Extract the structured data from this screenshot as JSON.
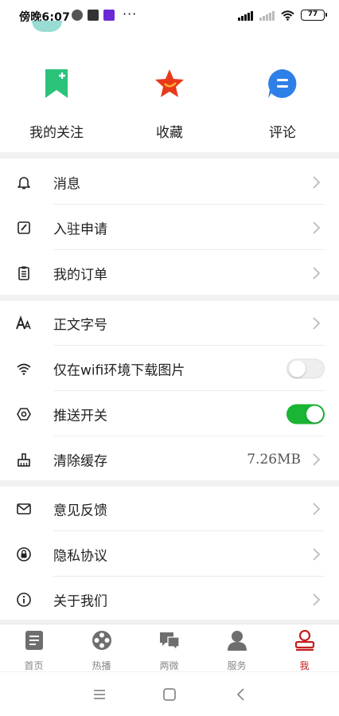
{
  "status_bar": {
    "time": "傍晚6:07",
    "dots": "···",
    "battery": "77"
  },
  "quick_actions": [
    {
      "label": "我的关注",
      "icon": "bookmark-plus-icon",
      "color": "#2bc27a"
    },
    {
      "label": "收藏",
      "icon": "star-icon",
      "color": "#e8391b"
    },
    {
      "label": "评论",
      "icon": "comment-icon",
      "color": "#2f7fe8"
    }
  ],
  "menu": {
    "messages": "消息",
    "apply": "入驻申请",
    "orders": "我的订单",
    "font_size": "正文字号",
    "wifi_images": "仅在wifi环境下载图片",
    "push": "推送开关",
    "clear_cache": "清除缓存",
    "cache_size": "7.26MB",
    "feedback": "意见反馈",
    "privacy": "隐私协议",
    "about": "关于我们"
  },
  "toggles": {
    "wifi_images": false,
    "push": true
  },
  "tabs": [
    {
      "label": "首页",
      "icon": "news-icon"
    },
    {
      "label": "热播",
      "icon": "film-reel-icon"
    },
    {
      "label": "两微",
      "icon": "chat-bubbles-icon"
    },
    {
      "label": "服务",
      "icon": "person-service-icon"
    },
    {
      "label": "我",
      "icon": "profile-icon",
      "active": true
    }
  ],
  "colors": {
    "accent": "#c41e1e",
    "toggle_on": "#19b533"
  }
}
